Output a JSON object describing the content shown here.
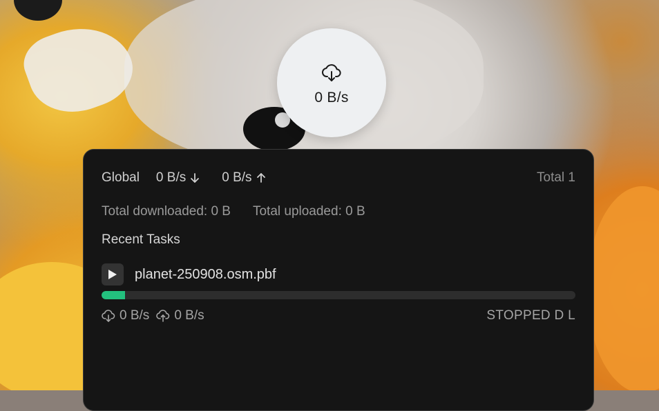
{
  "bubble": {
    "icon": "cloud-download-icon",
    "speed": "0 B/s"
  },
  "global": {
    "label": "Global",
    "download_rate": "0 B/s",
    "upload_rate": "0 B/s",
    "total": "Total 1"
  },
  "totals": {
    "downloaded": "Total downloaded: 0 B",
    "uploaded": "Total uploaded: 0 B"
  },
  "recent": {
    "heading": "Recent Tasks",
    "tasks": [
      {
        "name": "planet-250908.osm.pbf",
        "progress": 0.05,
        "download_speed": "0 B/s",
        "upload_speed": "0 B/s",
        "status": "STOPPED D L"
      }
    ]
  },
  "colors": {
    "panel_bg": "#151515",
    "progress_fill": "#23c07e",
    "progress_track": "#2d2d2d",
    "bubble_bg": "#eef0f2"
  }
}
